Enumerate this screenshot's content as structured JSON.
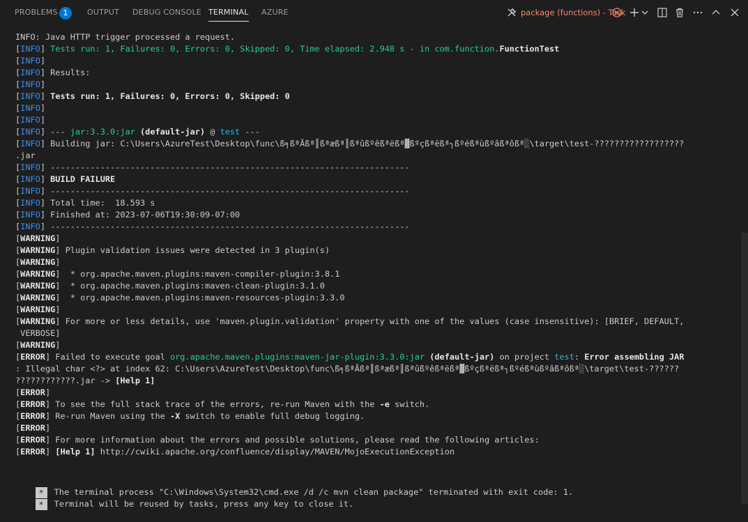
{
  "tabs": [
    {
      "label": "PROBLEMS",
      "badge": "1"
    },
    {
      "label": "OUTPUT"
    },
    {
      "label": "DEBUG CONSOLE"
    },
    {
      "label": "TERMINAL"
    },
    {
      "label": "AZURE"
    }
  ],
  "task_label": "package (functions) - Task",
  "colors": {
    "info": "#3b8eea",
    "success": "#23d18b",
    "warning": "#f5f543",
    "error": "#f14c4c",
    "accent": "#0078d4",
    "task": "#f48771"
  },
  "lines": [
    [
      {
        "t": "INFO: Java HTTP trigger processed a request."
      }
    ],
    [
      {
        "t": "["
      },
      {
        "t": "INFO",
        "c": "blue"
      },
      {
        "t": "] "
      },
      {
        "t": "Tests run: 1, Failures: 0, Errors: 0, Skipped: 0, Time elapsed: 2.948 s - in com.function.",
        "c": "green"
      },
      {
        "t": "FunctionTest",
        "c": "bold"
      }
    ],
    [
      {
        "t": "["
      },
      {
        "t": "INFO",
        "c": "blue"
      },
      {
        "t": "]"
      }
    ],
    [
      {
        "t": "["
      },
      {
        "t": "INFO",
        "c": "blue"
      },
      {
        "t": "] Results:"
      }
    ],
    [
      {
        "t": "["
      },
      {
        "t": "INFO",
        "c": "blue"
      },
      {
        "t": "]"
      }
    ],
    [
      {
        "t": "["
      },
      {
        "t": "INFO",
        "c": "blue"
      },
      {
        "t": "] "
      },
      {
        "t": "Tests run: 1, Failures: 0, Errors: 0, Skipped: 0",
        "c": "green bold"
      }
    ],
    [
      {
        "t": "["
      },
      {
        "t": "INFO",
        "c": "blue"
      },
      {
        "t": "]"
      }
    ],
    [
      {
        "t": "["
      },
      {
        "t": "INFO",
        "c": "blue"
      },
      {
        "t": "]"
      }
    ],
    [
      {
        "t": "["
      },
      {
        "t": "INFO",
        "c": "blue"
      },
      {
        "t": "] --- "
      },
      {
        "t": "jar:3.3.0:jar",
        "c": "green"
      },
      {
        "t": " "
      },
      {
        "t": "(default-jar)",
        "c": "bold"
      },
      {
        "t": " @ "
      },
      {
        "t": "test",
        "c": "cyan"
      },
      {
        "t": " ---"
      }
    ],
    [
      {
        "t": "["
      },
      {
        "t": "INFO",
        "c": "blue"
      },
      {
        "t": "] Building jar: C:\\Users\\AzureTest\\Desktop\\func\\ß╕ßªÃßª║ßªæßª║ßªûßºêßªëßª▓ßºçßªëßª┐ßºéßªùßºâßªôßª░\\target\\test-??????????????????"
      }
    ],
    [
      {
        "t": ".jar"
      }
    ],
    [
      {
        "t": "["
      },
      {
        "t": "INFO",
        "c": "blue"
      },
      {
        "t": "] ------------------------------------------------------------------------"
      }
    ],
    [
      {
        "t": "["
      },
      {
        "t": "INFO",
        "c": "blue"
      },
      {
        "t": "] "
      },
      {
        "t": "BUILD FAILURE",
        "c": "red bold"
      }
    ],
    [
      {
        "t": "["
      },
      {
        "t": "INFO",
        "c": "blue"
      },
      {
        "t": "] ------------------------------------------------------------------------"
      }
    ],
    [
      {
        "t": "["
      },
      {
        "t": "INFO",
        "c": "blue"
      },
      {
        "t": "] Total time:  18.593 s"
      }
    ],
    [
      {
        "t": "["
      },
      {
        "t": "INFO",
        "c": "blue"
      },
      {
        "t": "] Finished at: 2023-07-06T19:30:09-07:00"
      }
    ],
    [
      {
        "t": "["
      },
      {
        "t": "INFO",
        "c": "blue"
      },
      {
        "t": "] ------------------------------------------------------------------------"
      }
    ],
    [
      {
        "t": "["
      },
      {
        "t": "WARNING",
        "c": "yellow bold"
      },
      {
        "t": "]"
      }
    ],
    [
      {
        "t": "["
      },
      {
        "t": "WARNING",
        "c": "yellow bold"
      },
      {
        "t": "] Plugin validation issues were detected in 3 plugin(s)"
      }
    ],
    [
      {
        "t": "["
      },
      {
        "t": "WARNING",
        "c": "yellow bold"
      },
      {
        "t": "]"
      }
    ],
    [
      {
        "t": "["
      },
      {
        "t": "WARNING",
        "c": "yellow bold"
      },
      {
        "t": "]  * org.apache.maven.plugins:maven-compiler-plugin:3.8.1"
      }
    ],
    [
      {
        "t": "["
      },
      {
        "t": "WARNING",
        "c": "yellow bold"
      },
      {
        "t": "]  * org.apache.maven.plugins:maven-clean-plugin:3.1.0"
      }
    ],
    [
      {
        "t": "["
      },
      {
        "t": "WARNING",
        "c": "yellow bold"
      },
      {
        "t": "]  * org.apache.maven.plugins:maven-resources-plugin:3.3.0"
      }
    ],
    [
      {
        "t": "["
      },
      {
        "t": "WARNING",
        "c": "yellow bold"
      },
      {
        "t": "]"
      }
    ],
    [
      {
        "t": "["
      },
      {
        "t": "WARNING",
        "c": "yellow bold"
      },
      {
        "t": "] For more or less details, use 'maven.plugin.validation' property with one of the values (case insensitive): [BRIEF, DEFAULT,"
      }
    ],
    [
      {
        "t": " VERBOSE]"
      }
    ],
    [
      {
        "t": "["
      },
      {
        "t": "WARNING",
        "c": "yellow bold"
      },
      {
        "t": "]"
      }
    ],
    [
      {
        "t": "["
      },
      {
        "t": "ERROR",
        "c": "red bold"
      },
      {
        "t": "] Failed to execute goal "
      },
      {
        "t": "org.apache.maven.plugins:maven-jar-plugin:3.3.0:jar",
        "c": "green"
      },
      {
        "t": " "
      },
      {
        "t": "(default-jar)",
        "c": "bold"
      },
      {
        "t": " on project "
      },
      {
        "t": "test",
        "c": "cyan"
      },
      {
        "t": ": "
      },
      {
        "t": "Error assembling JAR",
        "c": "red bold"
      }
    ],
    [
      {
        "t": ": Illegal char <?> at index 62: C:\\Users\\AzureTest\\Desktop\\func\\ß╕ßªÃßª║ßªæßª║ßªûßºêßªëßª▓ßºçßªëßª┐ßºéßªùßºâßªôßª░\\target\\test-??????"
      }
    ],
    [
      {
        "t": "????????????.jar -> "
      },
      {
        "t": "[Help 1]",
        "c": "bold"
      }
    ],
    [
      {
        "t": "["
      },
      {
        "t": "ERROR",
        "c": "red bold"
      },
      {
        "t": "]"
      }
    ],
    [
      {
        "t": "["
      },
      {
        "t": "ERROR",
        "c": "red bold"
      },
      {
        "t": "] To see the full stack trace of the errors, re-run Maven with the "
      },
      {
        "t": "-e",
        "c": "bold"
      },
      {
        "t": " switch."
      }
    ],
    [
      {
        "t": "["
      },
      {
        "t": "ERROR",
        "c": "red bold"
      },
      {
        "t": "] Re-run Maven using the "
      },
      {
        "t": "-X",
        "c": "bold"
      },
      {
        "t": " switch to enable full debug logging."
      }
    ],
    [
      {
        "t": "["
      },
      {
        "t": "ERROR",
        "c": "red bold"
      },
      {
        "t": "]"
      }
    ],
    [
      {
        "t": "["
      },
      {
        "t": "ERROR",
        "c": "red bold"
      },
      {
        "t": "] For more information about the errors and possible solutions, please read the following articles:"
      }
    ],
    [
      {
        "t": "["
      },
      {
        "t": "ERROR",
        "c": "red bold"
      },
      {
        "t": "] "
      },
      {
        "t": "[Help 1]",
        "c": "bold"
      },
      {
        "t": " http://cwiki.apache.org/confluence/display/MAVEN/MojoExecutionException"
      }
    ]
  ],
  "task_messages": [
    {
      "marker": "*",
      "text": "The terminal process \"C:\\Windows\\System32\\cmd.exe /d /c mvn clean package\" terminated with exit code: 1."
    },
    {
      "marker": "*",
      "text": "Terminal will be reused by tasks, press any key to close it."
    }
  ]
}
